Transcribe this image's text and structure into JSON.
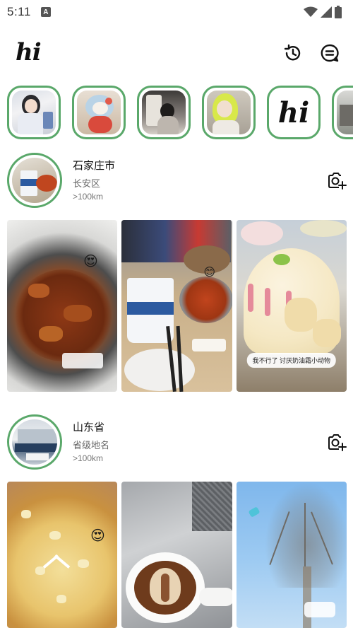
{
  "status_bar": {
    "time": "5:11",
    "notification_icon": "A"
  },
  "header": {
    "logo": "hi",
    "history_icon": "history-icon",
    "message_icon": "message-icon"
  },
  "stories": [
    {
      "name": "story-person-girl",
      "kind": "photo"
    },
    {
      "name": "story-plush-toy",
      "kind": "photo"
    },
    {
      "name": "story-window-figure",
      "kind": "photo"
    },
    {
      "name": "story-yellow-hair",
      "kind": "photo"
    },
    {
      "name": "story-hi-logo",
      "kind": "logo",
      "text": "hi"
    },
    {
      "name": "story-town",
      "kind": "photo"
    }
  ],
  "posts": [
    {
      "location": "石家庄市",
      "district": "长安区",
      "distance": ">100km",
      "photos": [
        {
          "caption": "",
          "desc": "fried chicken plate"
        },
        {
          "caption": "",
          "desc": "coffee cup and noodles"
        },
        {
          "caption": "我不行了 讨厌奶油霜小动物",
          "desc": "cake with cute animals"
        }
      ]
    },
    {
      "location": "山东省",
      "district": "省级地名",
      "distance": ">100km",
      "photos": [
        {
          "caption": "",
          "desc": "pizza"
        },
        {
          "caption": "",
          "desc": "latte art"
        },
        {
          "caption": "",
          "desc": "tree against sky"
        }
      ]
    }
  ],
  "colors": {
    "ring": "#5aa86a",
    "accent_red": "#e8312a"
  }
}
